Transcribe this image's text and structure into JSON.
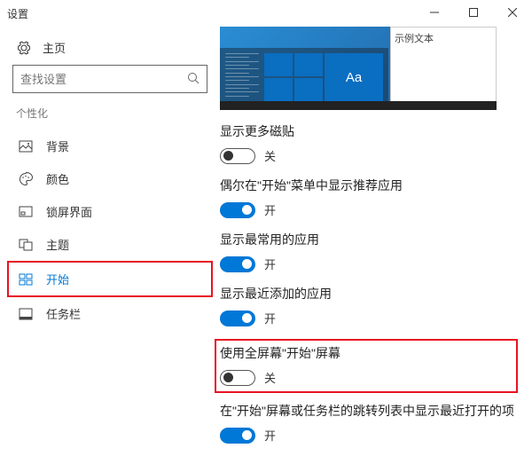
{
  "window": {
    "title": "设置"
  },
  "sidebar": {
    "home": "主页",
    "search_placeholder": "查找设置",
    "section": "个性化",
    "items": [
      {
        "label": "背景"
      },
      {
        "label": "颜色"
      },
      {
        "label": "锁屏界面"
      },
      {
        "label": "主题"
      },
      {
        "label": "开始"
      },
      {
        "label": "任务栏"
      }
    ]
  },
  "preview": {
    "sample_text": "Aa",
    "window_title": "示例文本"
  },
  "settings": [
    {
      "label": "显示更多磁贴",
      "state": "off",
      "state_text": "关"
    },
    {
      "label": "偶尔在\"开始\"菜单中显示推荐应用",
      "state": "on",
      "state_text": "开"
    },
    {
      "label": "显示最常用的应用",
      "state": "on",
      "state_text": "开"
    },
    {
      "label": "显示最近添加的应用",
      "state": "on",
      "state_text": "开"
    },
    {
      "label": "使用全屏幕\"开始\"屏幕",
      "state": "off",
      "state_text": "关",
      "highlight": true
    },
    {
      "label": "在\"开始\"屏幕或任务栏的跳转列表中显示最近打开的项",
      "state": "on",
      "state_text": "开"
    }
  ]
}
